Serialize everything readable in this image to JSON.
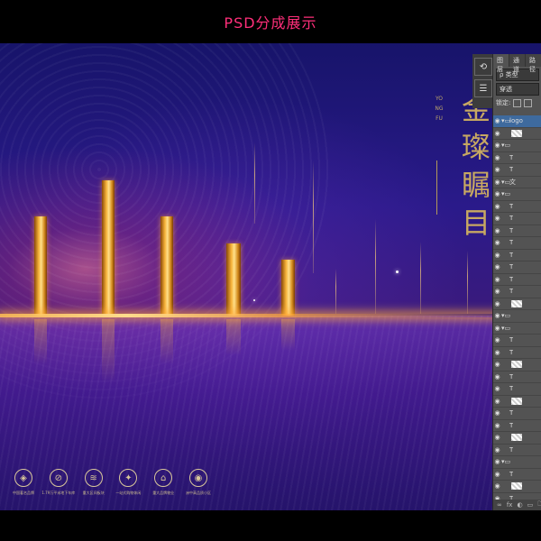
{
  "header": {
    "title": "PSD分成展示"
  },
  "artwork": {
    "vertical_small_text": "YONGFU",
    "vertical_title": "金璨瞩目",
    "icons": [
      {
        "icon": "diamond-icon",
        "glyph": "◈",
        "label": "中国著名品牌"
      },
      {
        "icon": "badge-icon",
        "glyph": "⊘",
        "label": "1.79万平米地下车库"
      },
      {
        "icon": "wave-icon",
        "glyph": "≋",
        "label": "重大区间板块"
      },
      {
        "icon": "crest-icon",
        "glyph": "✦",
        "label": "一站式购物休闲"
      },
      {
        "icon": "house-icon",
        "glyph": "⌂",
        "label": "重大品牌物业"
      },
      {
        "icon": "circle-icon",
        "glyph": "◉",
        "label": "洲中高品质小区"
      }
    ],
    "colors": {
      "accent": "#ff2f7a",
      "gold": "#c7a862",
      "bg": "#2a1a8a"
    }
  },
  "photoshop": {
    "dock_icons": [
      "history-icon",
      "properties-icon"
    ],
    "tabs": [
      "图层",
      "通道",
      "路径"
    ],
    "filter_label": "ρ 类型",
    "blend_mode": "穿透",
    "lock_label": "锁定:",
    "layers": [
      {
        "type": "folder",
        "name": "logo",
        "selected": true
      },
      {
        "type": "thumb",
        "name": ""
      },
      {
        "type": "folder",
        "name": ""
      },
      {
        "type": "text",
        "name": "T"
      },
      {
        "type": "text",
        "name": "T"
      },
      {
        "type": "folder",
        "name": "文"
      },
      {
        "type": "folder",
        "name": ""
      },
      {
        "type": "text",
        "name": "T"
      },
      {
        "type": "text",
        "name": "T"
      },
      {
        "type": "text",
        "name": "T"
      },
      {
        "type": "text",
        "name": "T"
      },
      {
        "type": "text",
        "name": "T"
      },
      {
        "type": "text",
        "name": "T"
      },
      {
        "type": "text",
        "name": "T"
      },
      {
        "type": "text",
        "name": "T"
      },
      {
        "type": "thumb",
        "name": ""
      },
      {
        "type": "folder",
        "name": ""
      },
      {
        "type": "folder",
        "name": ""
      },
      {
        "type": "text",
        "name": "T"
      },
      {
        "type": "text",
        "name": "T"
      },
      {
        "type": "thumb",
        "name": ""
      },
      {
        "type": "text",
        "name": "T"
      },
      {
        "type": "text",
        "name": "T"
      },
      {
        "type": "thumb",
        "name": ""
      },
      {
        "type": "text",
        "name": "T"
      },
      {
        "type": "text",
        "name": "T"
      },
      {
        "type": "thumb",
        "name": ""
      },
      {
        "type": "text",
        "name": "T"
      },
      {
        "type": "folder",
        "name": ""
      },
      {
        "type": "text",
        "name": "T"
      },
      {
        "type": "thumb",
        "name": ""
      },
      {
        "type": "text",
        "name": "T"
      }
    ],
    "footer": [
      "∞",
      "fx",
      "◐",
      "▭",
      "🗀",
      "▢",
      "🗑"
    ]
  }
}
